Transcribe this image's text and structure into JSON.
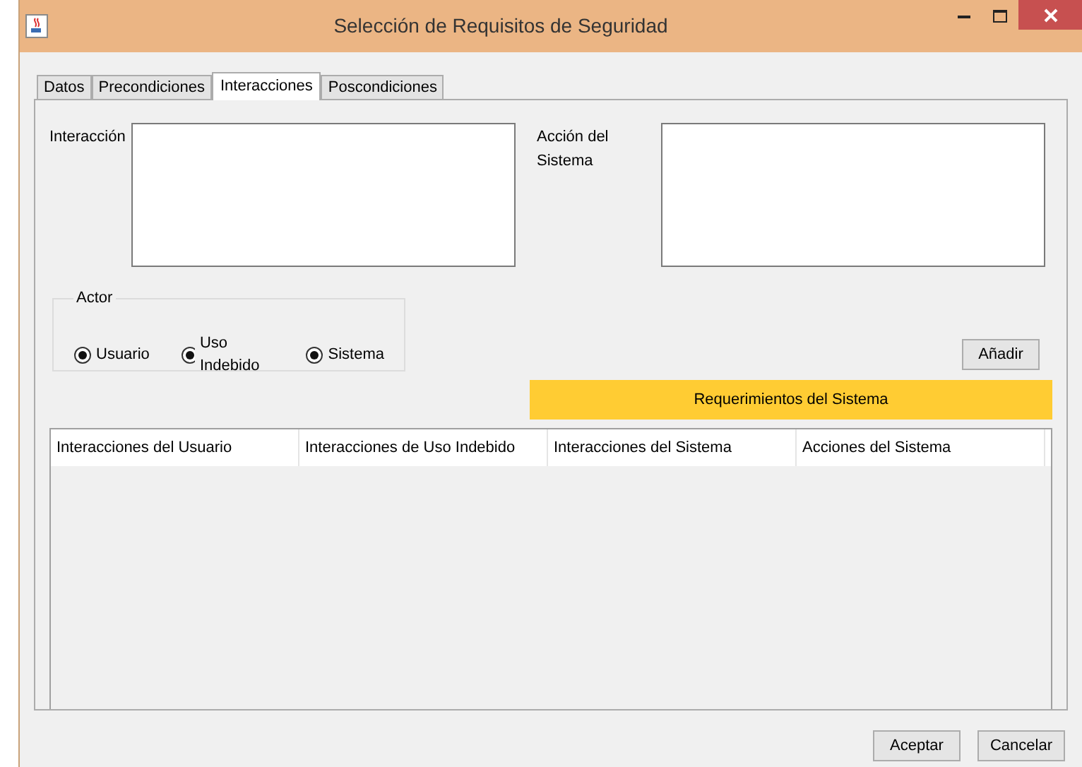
{
  "window": {
    "title": "Selección de Requisitos de Seguridad"
  },
  "tabs": [
    {
      "label": "Datos",
      "selected": false
    },
    {
      "label": "Precondiciones",
      "selected": false
    },
    {
      "label": "Interacciones",
      "selected": true
    },
    {
      "label": "Poscondiciones",
      "selected": false
    }
  ],
  "interaction_field": {
    "label": "Interacción"
  },
  "system_action_field": {
    "label": "Acción del Sistema"
  },
  "actor_group": {
    "title": "Actor",
    "options": [
      {
        "label": "Usuario",
        "selected": true
      },
      {
        "label": "Uso Indebido",
        "selected": true
      },
      {
        "label": "Sistema",
        "selected": true
      }
    ]
  },
  "add_button": "Añadir",
  "requirements_banner": "Requerimientos del Sistema",
  "table": {
    "columns": [
      "Interacciones del Usuario",
      "Interacciones de Uso Indebido",
      "Interacciones del Sistema",
      "Acciones del Sistema"
    ]
  },
  "buttons": [
    "Aceptar",
    "Cancelar"
  ]
}
